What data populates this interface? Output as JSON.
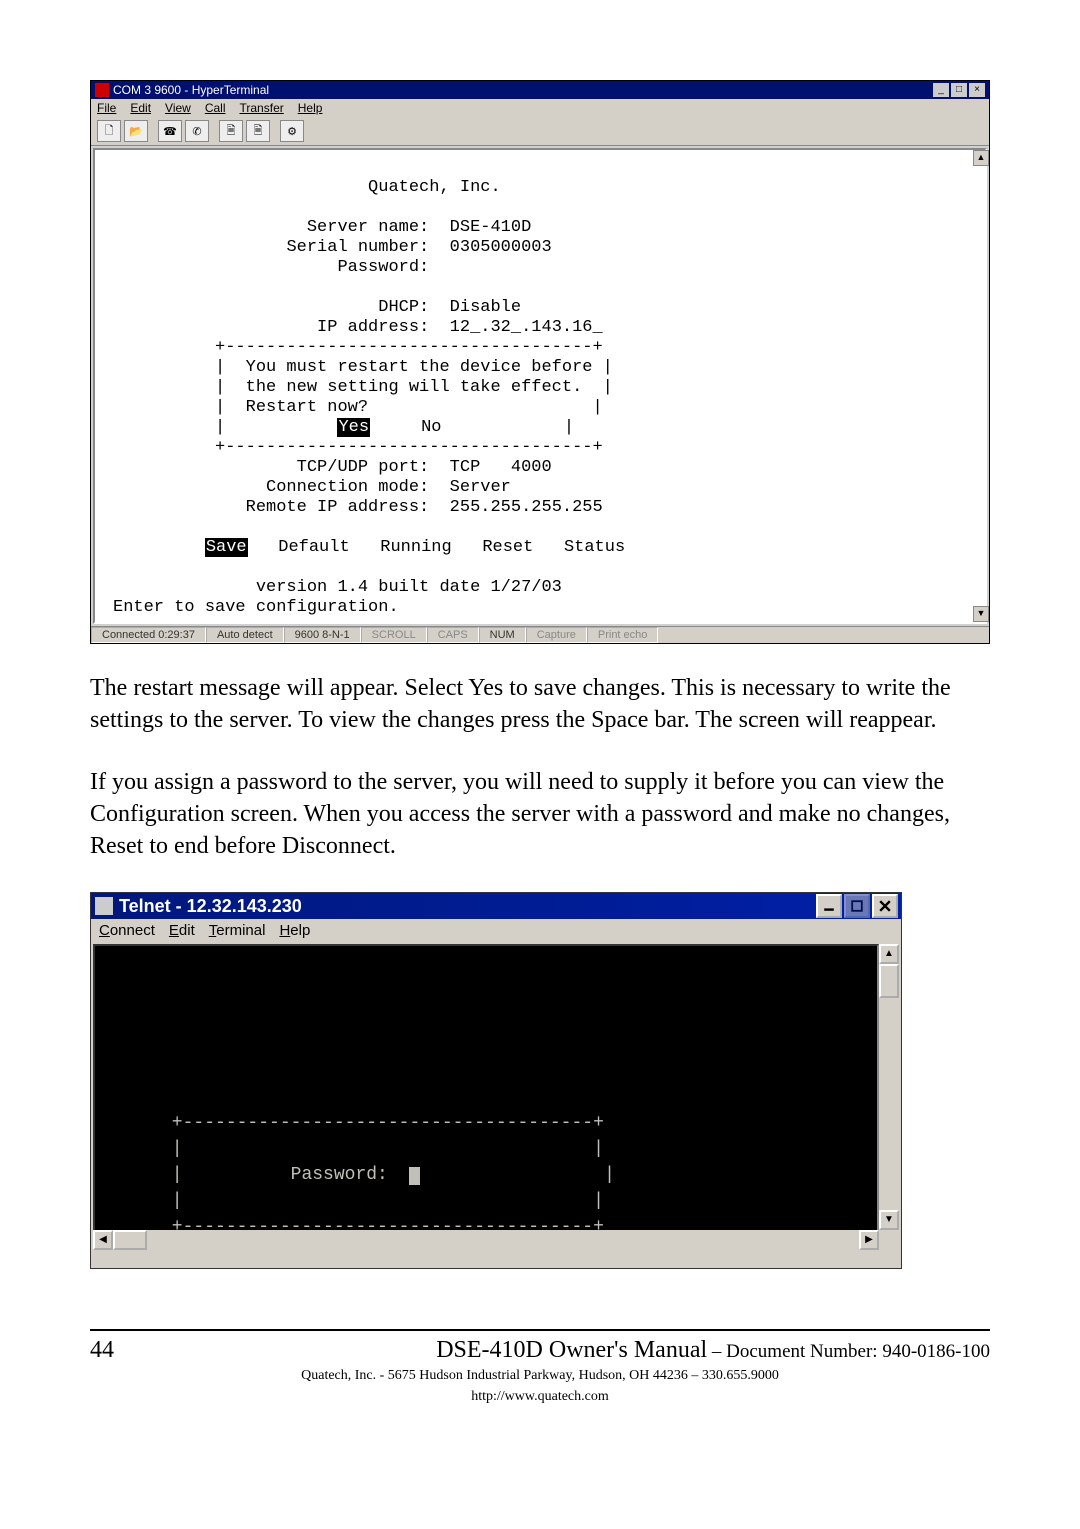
{
  "ht": {
    "title": "COM 3 9600 - HyperTerminal",
    "menu": [
      "File",
      "Edit",
      "View",
      "Call",
      "Transfer",
      "Help"
    ],
    "status": {
      "conn": "Connected 0:29:37",
      "detect": "Auto detect",
      "params": "9600 8-N-1",
      "scroll": "SCROLL",
      "caps": "CAPS",
      "num": "NUM",
      "capture": "Capture",
      "printecho": "Print echo"
    },
    "term": {
      "company": "Quatech, Inc.",
      "l_servername": "Server name:",
      "v_servername": "DSE-410D",
      "l_serial": "Serial number:",
      "v_serial": "0305000003",
      "l_password": "Password:",
      "l_dhcp": "DHCP:",
      "v_dhcp": "Disable",
      "l_ip": "IP address:",
      "v_ip": "12_.32_.143.16_",
      "msg1": "You must restart the device before",
      "msg2": "the new setting will take effect.",
      "msg3": "Restart now?",
      "yes": "Yes",
      "no": "No",
      "l_tcp": "TCP/UDP port:",
      "v_tcp_proto": "TCP",
      "v_tcp_port": "4000",
      "l_conn": "Connection mode:",
      "v_conn": "Server",
      "l_remote": "Remote IP address:",
      "v_remote": "255.255.255.255",
      "btn_save": "Save",
      "btn_default": "Default",
      "btn_running": "Running",
      "btn_reset": "Reset",
      "btn_status": "Status",
      "version": "version 1.4 built date 1/27/03",
      "prompt": "Enter to save configuration."
    }
  },
  "para1": "The restart message will appear. Select Yes to save changes. This is necessary to write the settings to the server. To view the changes press the Space bar. The screen will reappear.",
  "para2": "If you assign a password to the server, you will need to supply it before you can view the Configuration screen. When you access the server with a password and make no changes, Reset to end before Disconnect.",
  "tn": {
    "title": "Telnet - 12.32.143.230",
    "menu_connect": "Connect",
    "menu_edit": "Edit",
    "menu_terminal": "Terminal",
    "menu_help": "Help",
    "term_password": "Password:"
  },
  "footer": {
    "page": "44",
    "title": "DSE-410D Owner's Manual",
    "dash": " – ",
    "doclabel": "Document Number: 940-0186-100",
    "address": "Quatech, Inc. - 5675 Hudson Industrial Parkway, Hudson, OH 44236 – 330.655.9000",
    "url": "http://www.quatech.com"
  }
}
